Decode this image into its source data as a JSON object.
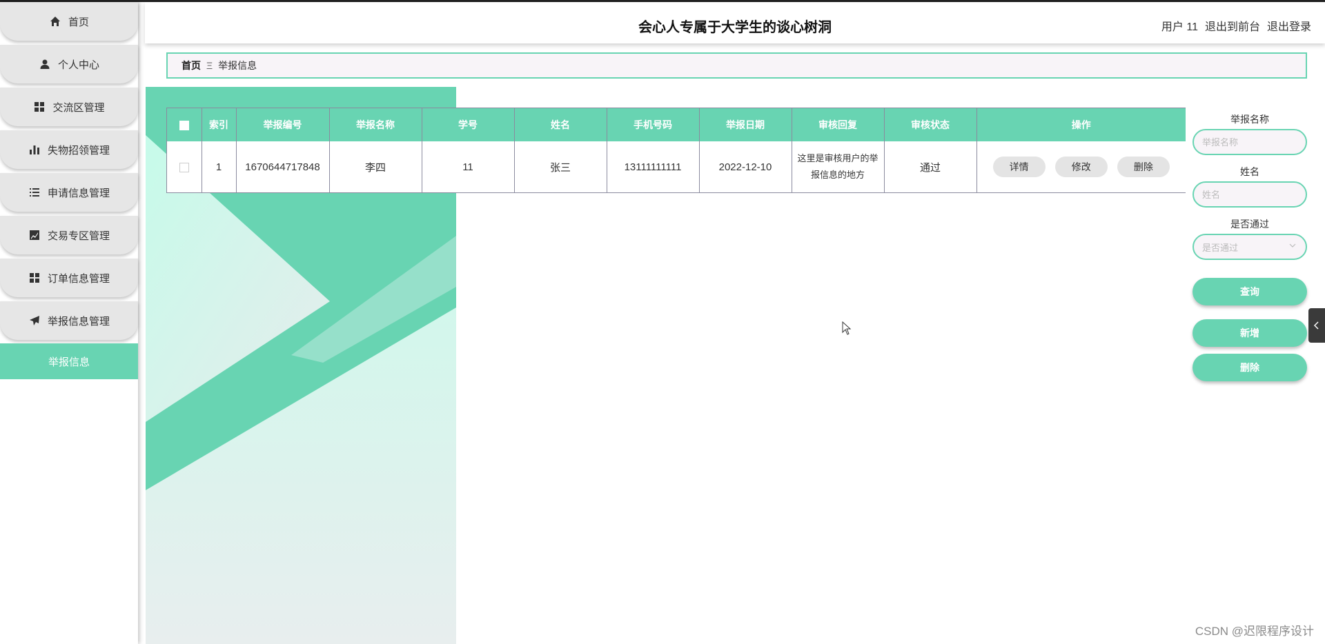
{
  "header": {
    "title": "会心人专属于大学生的谈心树洞",
    "user": "用户 11",
    "to_front": "退出到前台",
    "logout": "退出登录"
  },
  "sidebar": {
    "items": [
      {
        "label": "首页",
        "icon": "home-icon"
      },
      {
        "label": "个人中心",
        "icon": "user-icon"
      },
      {
        "label": "交流区管理",
        "icon": "grid-icon"
      },
      {
        "label": "失物招领管理",
        "icon": "bar-chart-icon"
      },
      {
        "label": "申请信息管理",
        "icon": "list-icon"
      },
      {
        "label": "交易专区管理",
        "icon": "line-chart-icon"
      },
      {
        "label": "订单信息管理",
        "icon": "grid-icon"
      },
      {
        "label": "举报信息管理",
        "icon": "paper-plane-icon"
      }
    ],
    "active_sub": "举报信息"
  },
  "breadcrumb": {
    "home": "首页",
    "separator": "Ξ",
    "current": "举报信息"
  },
  "table": {
    "columns": [
      "索引",
      "举报编号",
      "举报名称",
      "学号",
      "姓名",
      "手机号码",
      "举报日期",
      "审核回复",
      "审核状态",
      "操作"
    ],
    "rows": [
      {
        "index": "1",
        "report_no": "1670644717848",
        "report_name": "李四",
        "student_id": "11",
        "name": "张三",
        "phone": "13111111111",
        "date": "2022-12-10",
        "reply": "这里是审核用户的举报信息的地方",
        "status": "通过"
      }
    ],
    "actions": {
      "detail": "详情",
      "edit": "修改",
      "delete": "删除"
    }
  },
  "filter": {
    "report_name_label": "举报名称",
    "report_name_placeholder": "举报名称",
    "name_label": "姓名",
    "name_placeholder": "姓名",
    "passed_label": "是否通过",
    "passed_placeholder": "是否通过",
    "search": "查询",
    "add": "新增",
    "delete": "删除"
  },
  "watermark": "CSDN @迟限程序设计",
  "colors": {
    "accent": "#68d4b2",
    "menu_bg": "#e6e6e6",
    "border": "#8a8a9e"
  }
}
